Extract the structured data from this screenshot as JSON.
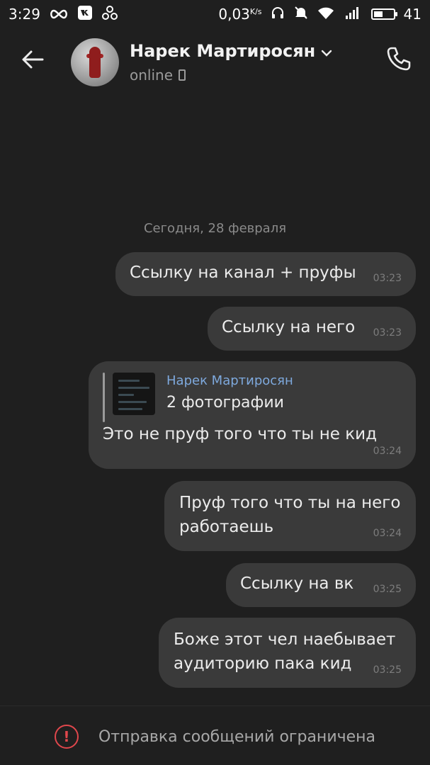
{
  "status_bar": {
    "time": "3:29",
    "speed": "0,03",
    "speed_unit": "K/s",
    "battery": "41",
    "icons": [
      "infinity-icon",
      "vk-icon",
      "network-icon",
      "headphones-icon",
      "mute-icon",
      "wifi-icon",
      "signal-4g-icon",
      "battery-icon"
    ]
  },
  "header": {
    "contact_name": "Нарек Мартиросян",
    "status": "online",
    "icons": {
      "back": "back-arrow-icon",
      "dropdown": "chevron-down-icon",
      "call": "phone-icon",
      "device": "mobile-device-icon"
    }
  },
  "date_separator": "Сегодня, 28 февраля",
  "messages": [
    {
      "text": "Ссылку на канал + пруфы",
      "time": "03:23"
    },
    {
      "text": "Ссылку на него",
      "time": "03:23"
    },
    {
      "reply": {
        "author": "Нарек Мартиросян",
        "text": "2 фотографии"
      },
      "text": "Это не пруф того что ты не кид",
      "time": "03:24"
    },
    {
      "line1": "Пруф того что ты на него",
      "line2": "работаешь",
      "time": "03:24"
    },
    {
      "text": "Ссылку на вк",
      "time": "03:25"
    },
    {
      "line1": "Боже этот чел наебывает",
      "line2": "аудиторию пака кид",
      "time": "03:25"
    }
  ],
  "footer": {
    "notice": "Отправка сообщений ограничена",
    "icon": "warning-icon",
    "icon_color": "#e0474c"
  },
  "colors": {
    "background": "#1f1f1f",
    "bubble": "#3a3a3a",
    "reply_author": "#7ea9dd"
  }
}
